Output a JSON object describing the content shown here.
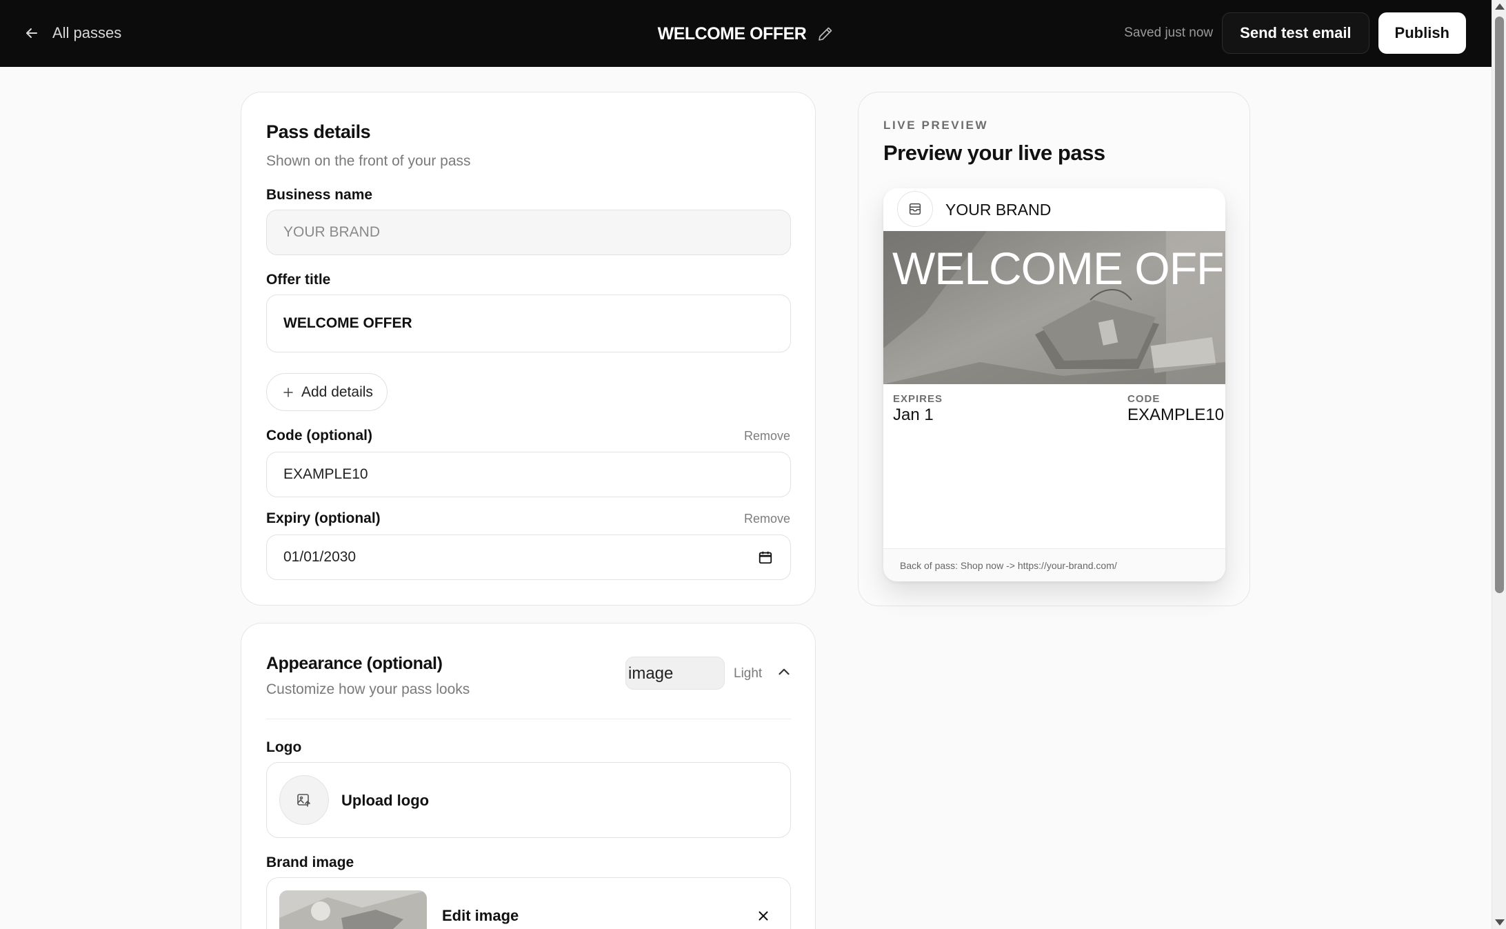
{
  "topbar": {
    "back_label": "All passes",
    "title": "WELCOME OFFER",
    "saved_status": "Saved just now",
    "send_test_label": "Send test email",
    "publish_label": "Publish"
  },
  "details": {
    "title": "Pass details",
    "subtitle": "Shown on the front of your pass",
    "business_name": {
      "label": "Business name",
      "value": "",
      "placeholder": "YOUR BRAND"
    },
    "offer_title": {
      "label": "Offer title",
      "value": "WELCOME OFFER"
    },
    "add_details_label": "Add details",
    "code": {
      "label": "Code (optional)",
      "remove_label": "Remove",
      "value": "EXAMPLE10"
    },
    "expiry": {
      "label": "Expiry (optional)",
      "remove_label": "Remove",
      "value": "01/01/2030"
    }
  },
  "appearance": {
    "title": "Appearance (optional)",
    "subtitle": "Customize how your pass looks",
    "style_value": "image",
    "theme_label": "Light",
    "logo": {
      "label": "Logo",
      "upload_label": "Upload logo"
    },
    "brand_image": {
      "label": "Brand image",
      "edit_label": "Edit image"
    }
  },
  "preview": {
    "eyebrow": "LIVE PREVIEW",
    "title": "Preview your live pass",
    "pass": {
      "brand": "YOUR BRAND",
      "offer_title": "WELCOME OFFER",
      "expires_label": "EXPIRES",
      "expires_value": "Jan 1",
      "code_label": "CODE",
      "code_value": "EXAMPLE10",
      "back_text": "Back of pass: Shop now -> https://your-brand.com/"
    }
  },
  "icons": {
    "back": "arrow-left-icon",
    "edit_title": "pencil-icon",
    "add": "plus-icon",
    "date": "calendar-icon",
    "collapse": "chevron-up-icon",
    "upload": "image-upload-icon",
    "remove_image": "close-icon",
    "pass_logo": "wallet-icon"
  },
  "colors": {
    "topbar_bg": "#0c0c0c",
    "page_bg": "#fafafa",
    "card_bg": "#ffffff",
    "accent": "#111111"
  }
}
